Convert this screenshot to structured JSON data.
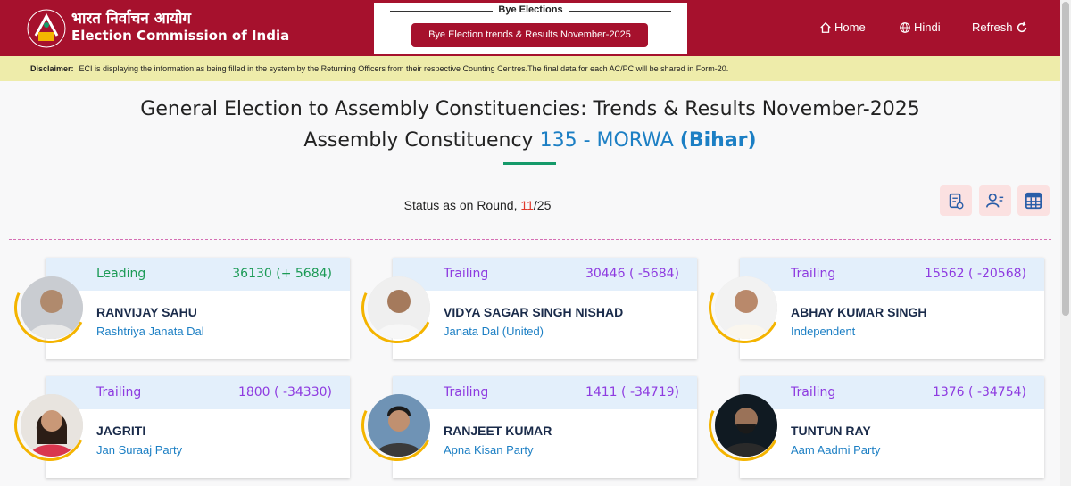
{
  "header": {
    "brand_hindi": "भारत निर्वाचन आयोग",
    "brand_en": "Election Commission of India",
    "bye_title": "Bye Elections",
    "bye_button": "Bye Election trends & Results November-2025",
    "nav": {
      "home": "Home",
      "hindi": "Hindi",
      "refresh": "Refresh"
    }
  },
  "disclaimer": {
    "label": "Disclaimer:",
    "text": "ECI is displaying the information as being filled in the system by the Returning Officers from their respective Counting Centres.The final data for each AC/PC will be shared in Form-20."
  },
  "page": {
    "title": "General Election to Assembly Constituencies: Trends & Results November-2025",
    "ac_prefix": "Assembly Constituency",
    "ac_number": "135 - MORWA",
    "ac_state": "(Bihar)"
  },
  "status": {
    "prefix": "Status as on Round,",
    "current_round": "11",
    "total_rounds": "/25"
  },
  "colors": {
    "brand": "#a6112d",
    "leading": "#1b9a55",
    "trailing": "#8e3be0",
    "link": "#1c7fc4"
  },
  "candidates": [
    {
      "status": "Leading",
      "votes": "36130 (+ 5684)",
      "name": "RANVIJAY SAHU",
      "party": "Rashtriya Janata Dal"
    },
    {
      "status": "Trailing",
      "votes": "30446 ( -5684)",
      "name": "VIDYA SAGAR SINGH NISHAD",
      "party": "Janata Dal (United)"
    },
    {
      "status": "Trailing",
      "votes": "15562 ( -20568)",
      "name": "ABHAY KUMAR SINGH",
      "party": "Independent"
    },
    {
      "status": "Trailing",
      "votes": "1800 ( -34330)",
      "name": "JAGRITI",
      "party": "Jan Suraaj Party"
    },
    {
      "status": "Trailing",
      "votes": "1411 ( -34719)",
      "name": "RANJEET KUMAR",
      "party": "Apna Kisan Party"
    },
    {
      "status": "Trailing",
      "votes": "1376 ( -34754)",
      "name": "TUNTUN RAY",
      "party": "Aam Aadmi Party"
    }
  ]
}
